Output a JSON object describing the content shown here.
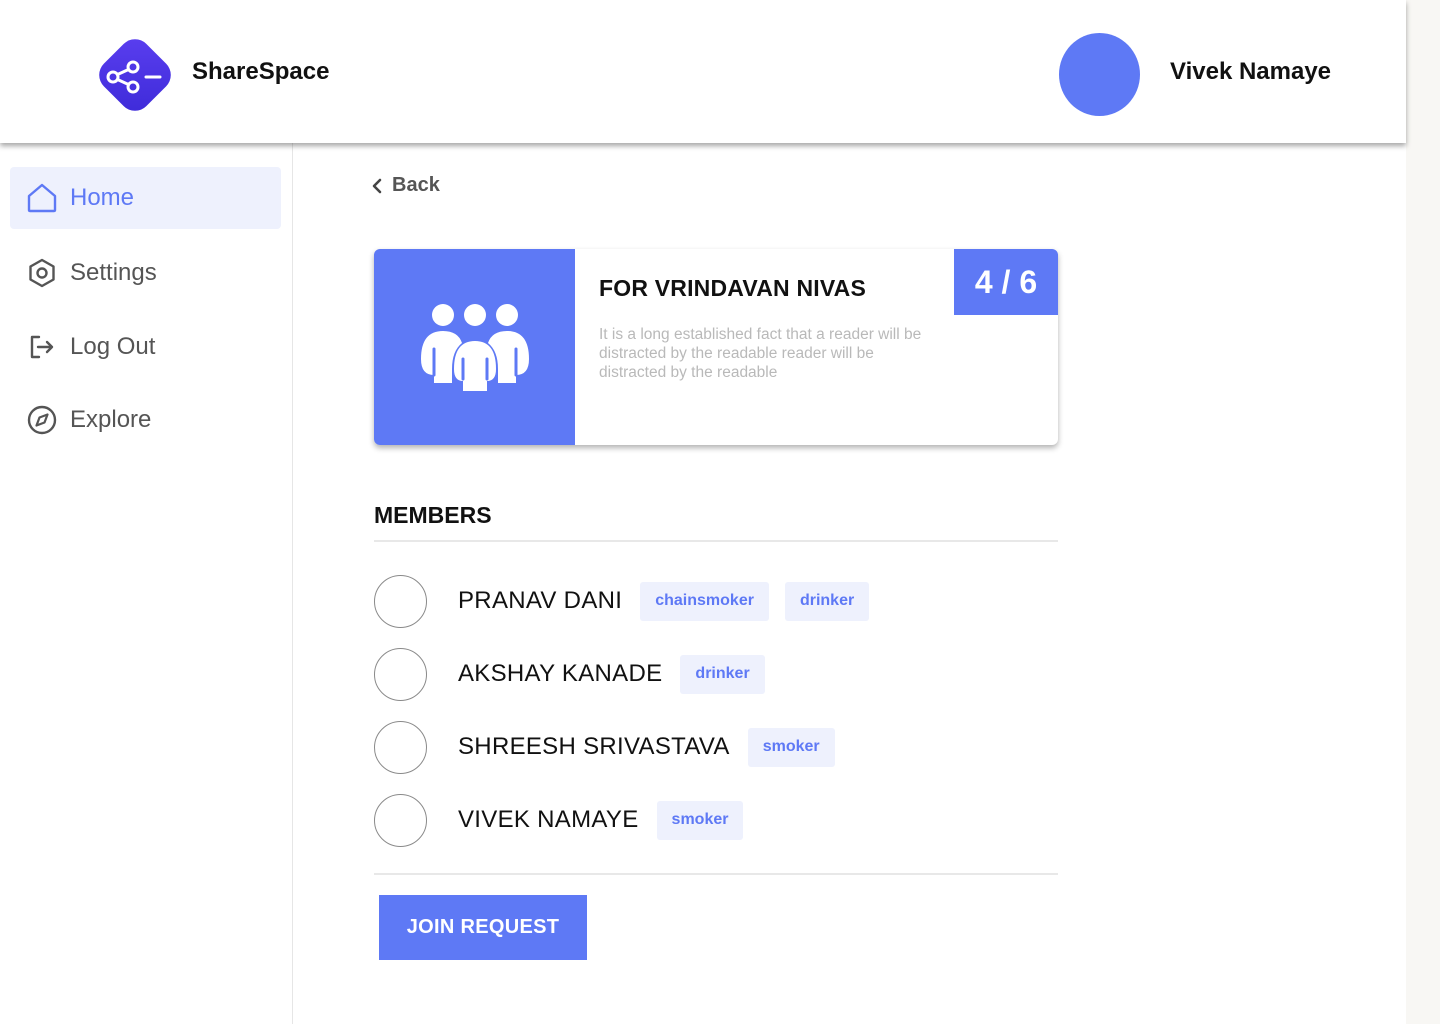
{
  "header": {
    "brand": "ShareSpace",
    "logo_icon": "share-nodes-icon",
    "user_name": "Vivek Namaye",
    "accent": "#5e79f5"
  },
  "sidebar": {
    "items": [
      {
        "label": "Home",
        "icon": "home-icon",
        "active": true
      },
      {
        "label": "Settings",
        "icon": "hexagon-gear-icon",
        "active": false
      },
      {
        "label": "Log Out",
        "icon": "logout-icon",
        "active": false
      },
      {
        "label": "Explore",
        "icon": "compass-icon",
        "active": false
      }
    ]
  },
  "main": {
    "back_label": "Back",
    "card": {
      "title": "FOR VRINDAVAN NIVAS",
      "description": "It is a long established fact that a reader will be distracted by the readable  reader will be distracted by the readable",
      "occupancy": "4 / 6",
      "image_icon": "group-people-icon"
    },
    "members_heading": "MEMBERS",
    "members": [
      {
        "name": "PRANAV DANI",
        "tags": [
          "chainsmoker",
          "drinker"
        ]
      },
      {
        "name": "AKSHAY KANADE",
        "tags": [
          "drinker"
        ]
      },
      {
        "name": "SHREESH SRIVASTAVA",
        "tags": [
          "smoker"
        ]
      },
      {
        "name": "VIVEK NAMAYE",
        "tags": [
          "smoker"
        ]
      }
    ],
    "join_label": "JOIN REQUEST"
  }
}
